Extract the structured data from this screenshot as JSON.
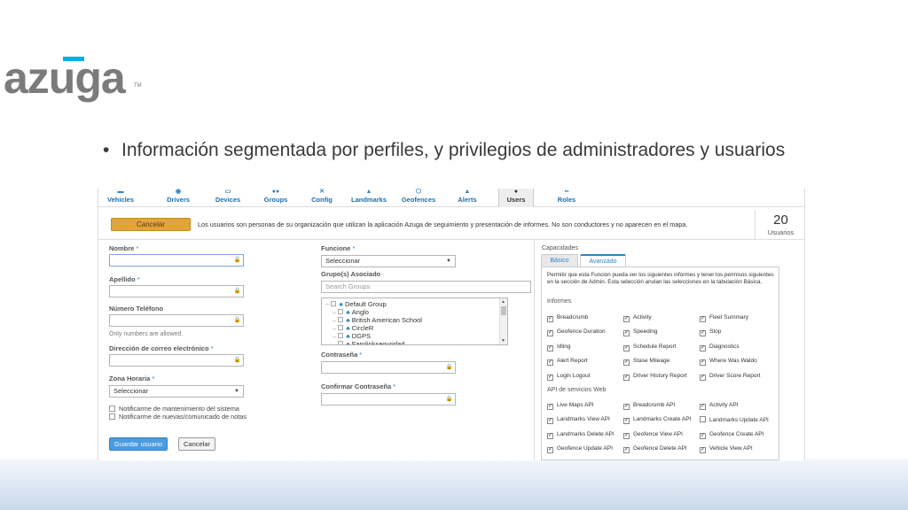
{
  "slide": {
    "logo_text": "azuga",
    "logo_tm": "TM",
    "bullet_symbol": "•",
    "bullet_text": "Información segmentada por perfiles, y privilegios de administradores y usuarios"
  },
  "nav": {
    "items": [
      {
        "label": "Vehicles",
        "icon": "car-icon"
      },
      {
        "label": "Drivers",
        "icon": "driver-icon"
      },
      {
        "label": "Devices",
        "icon": "device-icon"
      },
      {
        "label": "Groups",
        "icon": "groups-icon"
      },
      {
        "label": "Config",
        "icon": "wrench-icon"
      },
      {
        "label": "Landmarks",
        "icon": "landmark-icon"
      },
      {
        "label": "Geofences",
        "icon": "geofence-icon"
      },
      {
        "label": "Alerts",
        "icon": "alert-icon"
      },
      {
        "label": "Users",
        "icon": "user-icon"
      },
      {
        "label": "Roles",
        "icon": "roles-icon"
      }
    ],
    "active": "Users"
  },
  "topbar": {
    "cancel_label": "Cancelar",
    "message": "Los usuarios son personas de su organización que utilizan la aplicación Azuga de seguimiento y presentación de informes. No son conductores y no aparecen en el mapa.",
    "count": "20",
    "count_label": "Usuarios"
  },
  "form": {
    "required_mark": "*",
    "lock_glyph": "🔒",
    "nombre_label": "Nombre",
    "apellido_label": "Apellido",
    "telefono_label": "Número Teléfono",
    "telefono_hint": "Only numbers are allowed.",
    "correo_label": "Dirección de correo electrónico",
    "zona_label": "Zona Horaria",
    "zona_value": "Seleccionar",
    "notify_maintenance": "Notificarme de mantenimiento del sistema",
    "notify_news": "Notificarme de nuevas/comunicado de notas",
    "save_label": "Guardar usuario",
    "cancel_label": "Cancelar",
    "funcione_label": "Funcione",
    "funcione_value": "Seleccionar",
    "grupos_label": "Grupo(s) Asociado",
    "grupos_placeholder": "Search Groups",
    "contrasena_label": "Contraseña",
    "confirmar_label": "Confirmar Contraseña"
  },
  "tree": {
    "root": "Default Group",
    "children": [
      "Anglo",
      "British American School",
      "CircleR",
      "DGPS",
      "Farnlinkseguridad"
    ]
  },
  "capabilities": {
    "title": "Capacidades",
    "tab_basic": "Básico",
    "tab_advanced": "Avanzado",
    "description": "Permitir que esta Funcion pueda ver los siguientes informes y tener los permisos siguientes en la sección de Admin. Esta selección anulan las selecciones en la tabulación Básica.",
    "informes_heading": "Informes",
    "informes": [
      {
        "label": "Breadcrumb",
        "checked": true
      },
      {
        "label": "Activity",
        "checked": true
      },
      {
        "label": "Fleet Summary",
        "checked": true
      },
      {
        "label": "Geofence Duration",
        "checked": true
      },
      {
        "label": "Speeding",
        "checked": true
      },
      {
        "label": "Stop",
        "checked": true
      },
      {
        "label": "Idling",
        "checked": true
      },
      {
        "label": "Schedule Report",
        "checked": true
      },
      {
        "label": "Diagnostics",
        "checked": true
      },
      {
        "label": "Alert Report",
        "checked": true
      },
      {
        "label": "Stase Mileage",
        "checked": true
      },
      {
        "label": "Where Was Waldo",
        "checked": true
      },
      {
        "label": "Login Logout",
        "checked": true
      },
      {
        "label": "Driver History Report",
        "checked": true
      },
      {
        "label": "Driver Score Report",
        "checked": true
      }
    ],
    "api_heading": "API de servicios Web",
    "api": [
      {
        "label": "Live Maps API",
        "checked": true
      },
      {
        "label": "Breadcrumb API",
        "checked": true
      },
      {
        "label": "Activity API",
        "checked": true
      },
      {
        "label": "Landmarks View API",
        "checked": true
      },
      {
        "label": "Landmarks Create API",
        "checked": true
      },
      {
        "label": "Landmarks Update API",
        "checked": false
      },
      {
        "label": "Landmarks Delete API",
        "checked": true
      },
      {
        "label": "Geofence View API",
        "checked": true
      },
      {
        "label": "Geofence Create API",
        "checked": true
      },
      {
        "label": "Geofence Update API",
        "checked": true
      },
      {
        "label": "Geofence Delete API",
        "checked": true
      },
      {
        "label": "Vehicle View API",
        "checked": true
      }
    ],
    "check_glyph": "✓"
  },
  "colors": {
    "accent": "#2b84c6",
    "cancel_orange": "#e2a437",
    "save_blue": "#4a9be0",
    "logo_gray": "#7b7b7b",
    "logo_blue": "#00aeef"
  }
}
